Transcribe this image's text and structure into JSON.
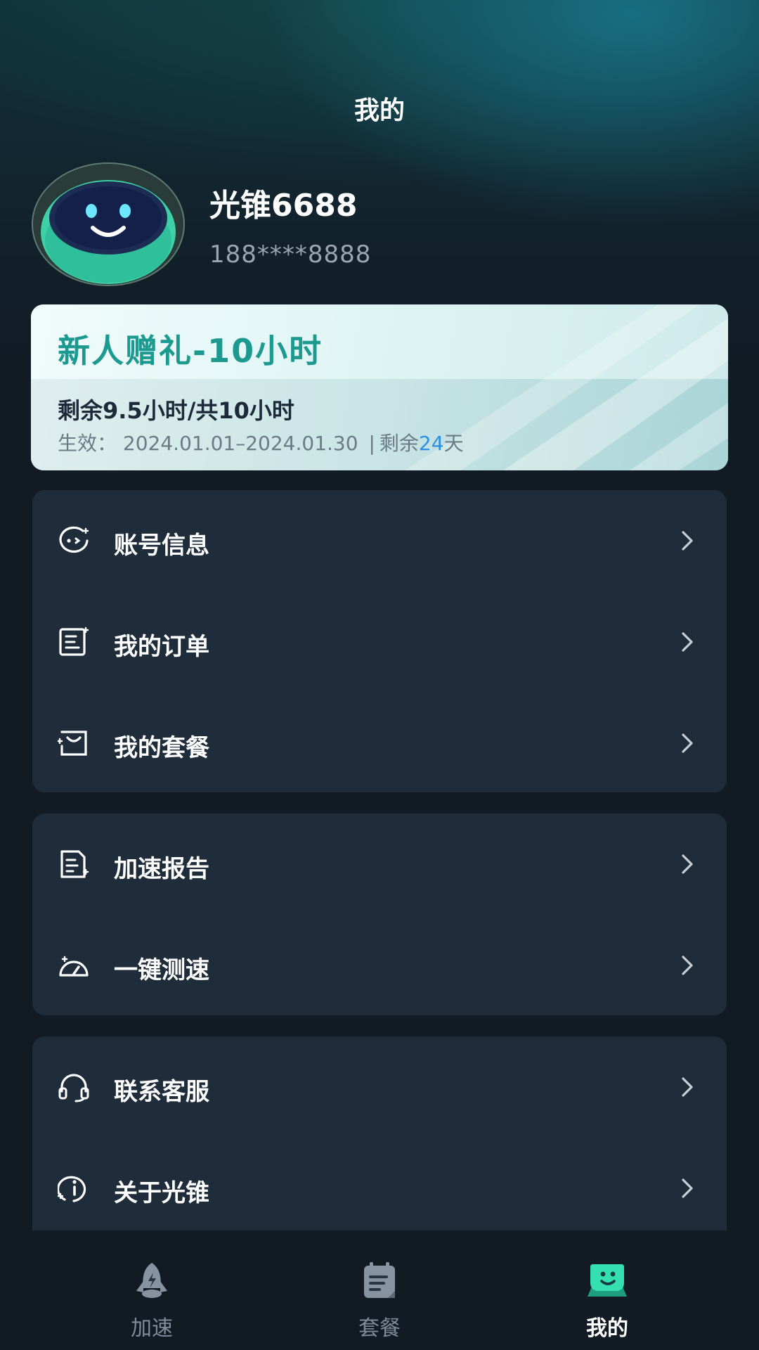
{
  "header": {
    "title": "我的"
  },
  "profile": {
    "username": "光锥6688",
    "phone": "188****8888"
  },
  "promo": {
    "title": "新人赠礼-10小时",
    "remaining": "剩余9.5小时/共10小时",
    "valid_prefix": "生效：",
    "valid_range": "2024.01.01–2024.01.30",
    "separator": "|",
    "days_prefix": "剩余",
    "days_value": "24",
    "days_suffix": "天"
  },
  "menu_groups": [
    {
      "items": [
        {
          "label": "账号信息",
          "icon": "account-info-icon"
        },
        {
          "label": "我的订单",
          "icon": "orders-icon"
        },
        {
          "label": "我的套餐",
          "icon": "package-icon"
        }
      ]
    },
    {
      "items": [
        {
          "label": "加速报告",
          "icon": "report-icon"
        },
        {
          "label": "一键测速",
          "icon": "speedometer-icon"
        }
      ]
    },
    {
      "items": [
        {
          "label": "联系客服",
          "icon": "headset-icon"
        },
        {
          "label": "关于光锥",
          "icon": "info-icon"
        }
      ]
    }
  ],
  "tabbar": {
    "tabs": [
      {
        "label": "加速",
        "icon": "rocket-icon",
        "active": false
      },
      {
        "label": "套餐",
        "icon": "calendar-icon",
        "active": false
      },
      {
        "label": "我的",
        "icon": "smile-face-icon",
        "active": true
      }
    ]
  },
  "colors": {
    "accent_green": "#1d9a8f",
    "days_blue": "#2f8fe0",
    "card_bg": "#1f2d3a",
    "page_bg": "#121a24"
  }
}
